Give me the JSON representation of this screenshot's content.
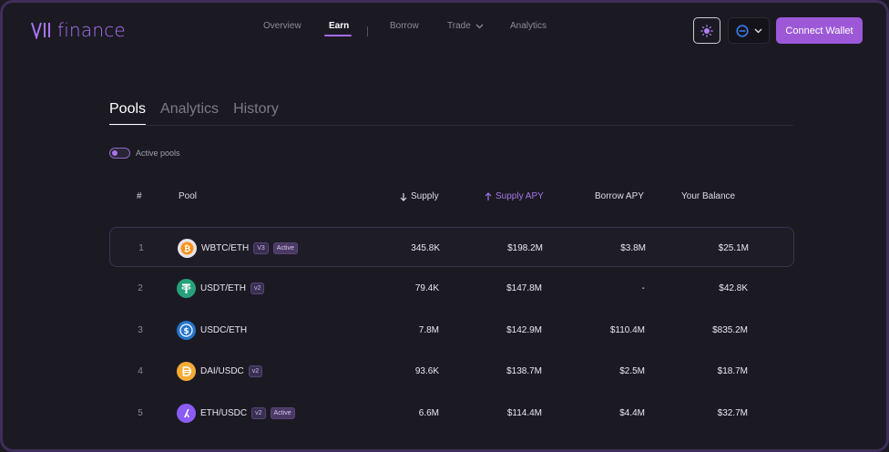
{
  "app": {
    "logo_text": "finance"
  },
  "nav": {
    "items": [
      {
        "label": "Overview"
      },
      {
        "label": "Earn"
      },
      {
        "label": "Borrow"
      },
      {
        "label": "Trade"
      },
      {
        "label": "Analytics"
      }
    ],
    "active": "Earn"
  },
  "header": {
    "theme_icon": "sun-icon",
    "network_icon": "network-icon",
    "connect_label": "Connect Wallet"
  },
  "tabs": [
    {
      "label": "Pools",
      "active": true
    },
    {
      "label": "Analytics",
      "active": false
    },
    {
      "label": "History",
      "active": false
    }
  ],
  "filter": {
    "toggle_label": "Active pools"
  },
  "table": {
    "columns": [
      "#",
      "Pool",
      "Supply",
      "Supply APY",
      "Borrow APY",
      "Your Balance"
    ],
    "rows": [
      {
        "index": "1",
        "pool": "WBTC/ETH",
        "version": "V3",
        "active": "Active",
        "supply": "345.8K",
        "supply_apy": "$198.2M",
        "borrow_apy": "$3.8M",
        "balance": "$25.1M",
        "icon": "bitcoin-icon",
        "color": "#f7931a"
      },
      {
        "index": "2",
        "pool": "USDT/ETH",
        "version": "v2",
        "active": "",
        "supply": "79.4K",
        "supply_apy": "$147.8M",
        "borrow_apy": "-",
        "balance": "$42.8K",
        "icon": "tether-icon",
        "color": "#26a17b"
      },
      {
        "index": "3",
        "pool": "USDC/ETH",
        "version": "",
        "active": "",
        "supply": "7.8M",
        "supply_apy": "$142.9M",
        "borrow_apy": "$110.4M",
        "balance": "$835.2M",
        "icon": "usdc-icon",
        "color": "#2775ca"
      },
      {
        "index": "4",
        "pool": "DAI/USDC",
        "version": "v2",
        "active": "",
        "supply": "93.6K",
        "supply_apy": "$138.7M",
        "borrow_apy": "$2.5M",
        "balance": "$18.7M",
        "icon": "dai-icon",
        "color": "#f5ac37"
      },
      {
        "index": "5",
        "pool": "ETH/USDC",
        "version": "v2",
        "active": "Active",
        "supply": "6.6M",
        "supply_apy": "$114.4M",
        "borrow_apy": "$4.4M",
        "balance": "$32.7M",
        "icon": "arbitrum-icon",
        "color": "#8b5cf6"
      }
    ]
  },
  "colors": {
    "accent": "#9d58d8",
    "background": "#1b1a23"
  }
}
